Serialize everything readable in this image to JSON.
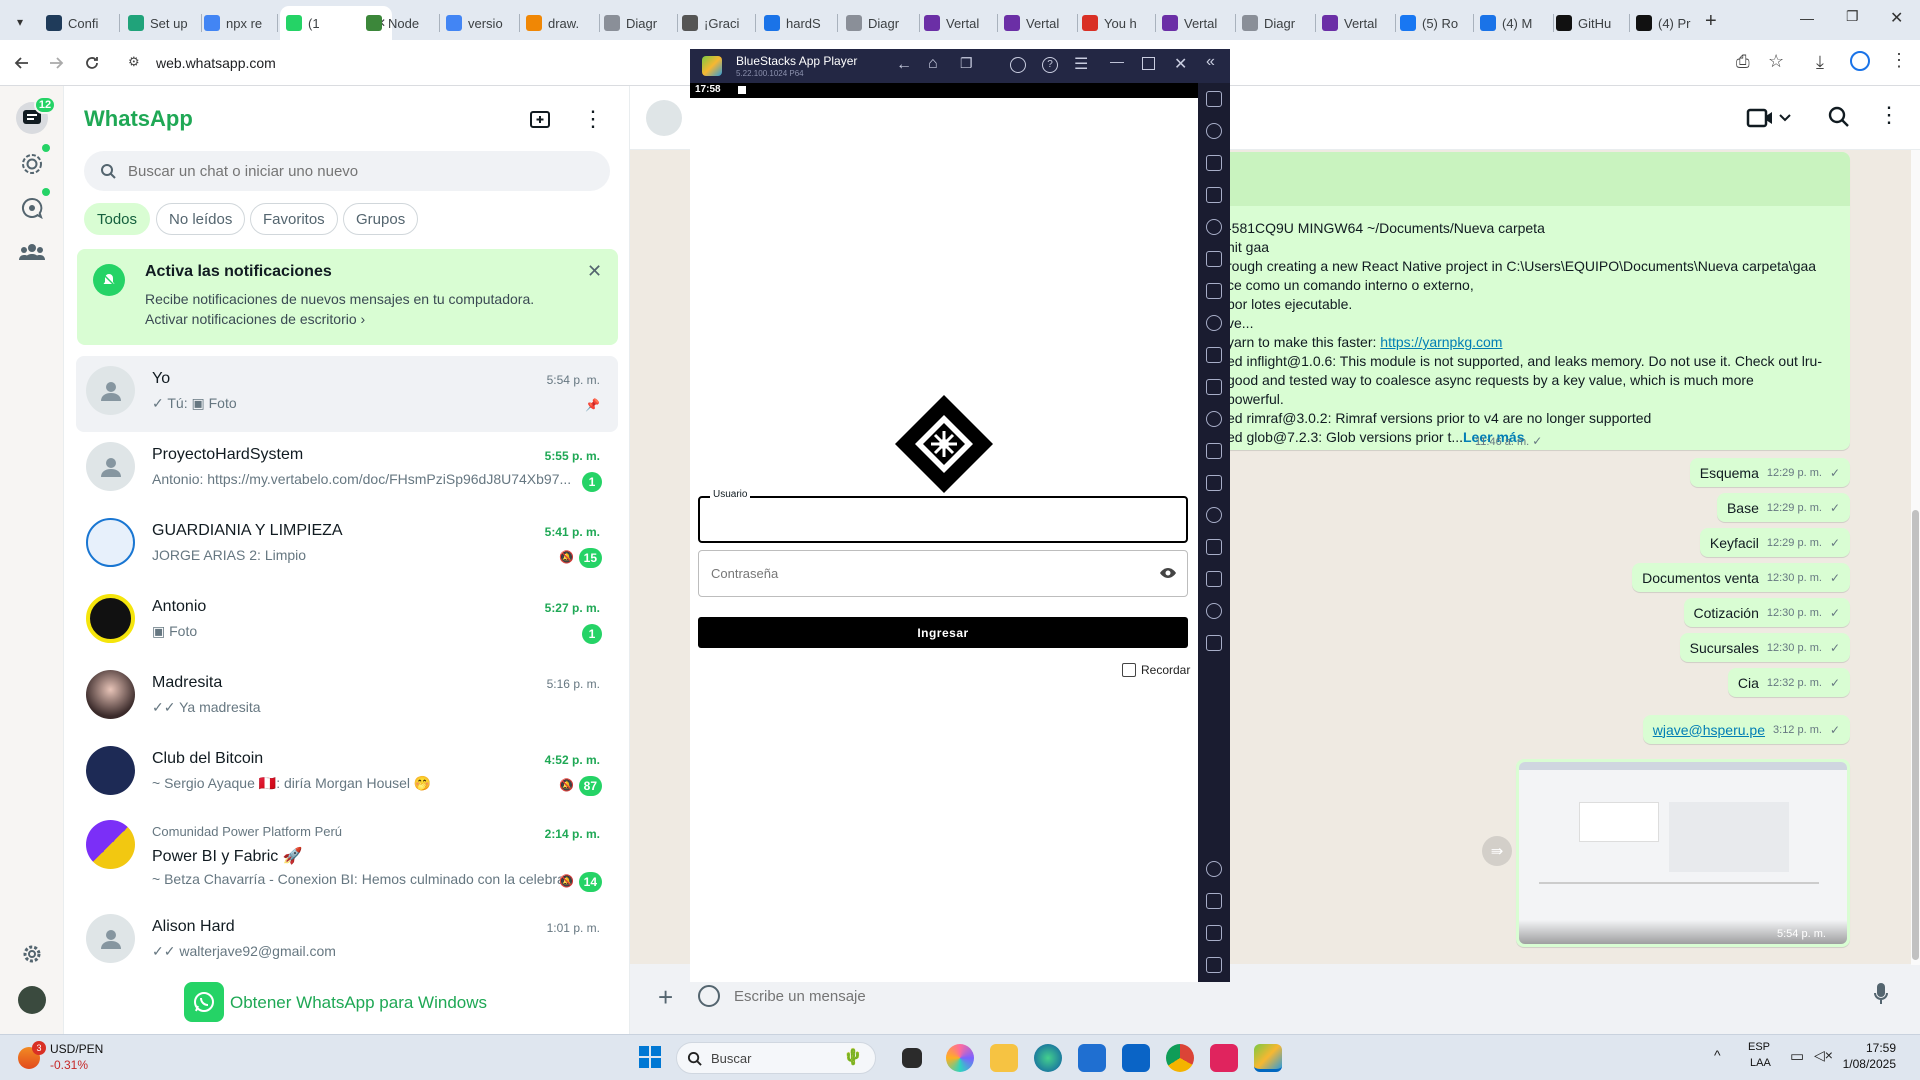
{
  "browser": {
    "tabs": [
      {
        "label": "Confi",
        "color": "#1f3b5a",
        "icon": "gear-icon"
      },
      {
        "label": "Set up",
        "color": "#20a37a",
        "icon": "page-icon"
      },
      {
        "label": "npx re",
        "color": "#4285f4",
        "icon": "google-icon"
      },
      {
        "label": "(1",
        "color": "#25d366",
        "icon": "whatsapp-icon",
        "active": true
      },
      {
        "label": "Node",
        "color": "#3c873a",
        "icon": "node-icon"
      },
      {
        "label": "versio",
        "color": "#4285f4",
        "icon": "google-icon"
      },
      {
        "label": "draw.",
        "color": "#f08705",
        "icon": "drawio-icon"
      },
      {
        "label": "Diagr",
        "color": "#8a8f98",
        "icon": "diagram-icon"
      },
      {
        "label": "¡Graci",
        "color": "#555",
        "icon": "globe-icon"
      },
      {
        "label": "hardS",
        "color": "#1a73e8",
        "icon": "drive-icon"
      },
      {
        "label": "Diagr",
        "color": "#8a8f98",
        "icon": "diagram-icon"
      },
      {
        "label": "Vertal",
        "color": "#6b2fa6",
        "icon": "vertabelo-icon"
      },
      {
        "label": "Vertal",
        "color": "#6b2fa6",
        "icon": "vertabelo-icon"
      },
      {
        "label": "You h",
        "color": "#d93025",
        "icon": "gmail-icon"
      },
      {
        "label": "Vertal",
        "color": "#6b2fa6",
        "icon": "vertabelo-icon"
      },
      {
        "label": "Diagr",
        "color": "#8a8f98",
        "icon": "diagram-icon"
      },
      {
        "label": "Vertal",
        "color": "#6b2fa6",
        "icon": "vertabelo-icon"
      },
      {
        "label": "(5) Ro",
        "color": "#1877f2",
        "icon": "reddit-icon"
      },
      {
        "label": "(4) M",
        "color": "#1a73e8",
        "icon": "search-icon"
      },
      {
        "label": "GitHu",
        "color": "#111",
        "icon": "github-icon"
      },
      {
        "label": "(4) Pr",
        "color": "#111",
        "icon": "notion-icon"
      }
    ],
    "url": "web.whatsapp.com"
  },
  "whatsapp": {
    "title": "WhatsApp",
    "unread_total": "12",
    "search_placeholder": "Buscar un chat o iniciar uno nuevo",
    "filters": [
      "Todos",
      "No leídos",
      "Favoritos",
      "Grupos"
    ],
    "notification": {
      "title": "Activa las notificaciones",
      "body": "Recibe notificaciones de nuevos mensajes en tu computadora.",
      "link": "Activar notificaciones de escritorio"
    },
    "chats": [
      {
        "name": "Yo",
        "preview": "✓ Tú: ▣ Foto",
        "time": "5:54 p. m.",
        "unread": "",
        "pinned": true,
        "avatar": "group"
      },
      {
        "name": "ProyectoHardSystem",
        "preview": "Antonio: https://my.vertabelo.com/doc/FHsmPziSp96dJ8U74Xb97...",
        "time": "5:55 p. m.",
        "unread": "1",
        "avatar": "group"
      },
      {
        "name": "GUARDIANIA Y LIMPIEZA",
        "preview": "JORGE ARIAS 2: Limpio",
        "time": "5:41 p. m.",
        "unread": "15",
        "muted": true,
        "avatar": "crest"
      },
      {
        "name": "Antonio",
        "preview": "▣ Foto",
        "time": "5:27 p. m.",
        "unread": "1",
        "avatar": "yellow"
      },
      {
        "name": "Madresita",
        "preview": "✓✓ Ya madresita",
        "time": "5:16 p. m.",
        "unread": "",
        "avatar": "photo"
      },
      {
        "name": "Club del Bitcoin",
        "preview": "~ Sergio Ayaque 🇵🇪: diría Morgan Housel 🤭",
        "time": "4:52 p. m.",
        "unread": "87",
        "muted": true,
        "avatar": "bitcoin"
      },
      {
        "name": "Power BI y Fabric 🚀",
        "community": "Comunidad Power Platform Perú",
        "preview": "~ Betza Chavarría - Conexion BI: Hemos culminado con la celebración ...",
        "time": "2:14 p. m.",
        "unread": "14",
        "muted": true,
        "avatar": "powerbi"
      },
      {
        "name": "Alison Hard",
        "preview": "✓✓ walterjave92@gmail.com",
        "time": "1:01 p. m.",
        "unread": "",
        "avatar": "person"
      }
    ],
    "get_app": "Obtener WhatsApp para Windows",
    "composer_placeholder": "Escribe un mensaje",
    "long_message": {
      "lines": [
        "-581CQ9U MINGW64 ~/Documents/Nueva carpeta",
        "nit gaa",
        "rough creating a new React Native project in C:\\Users\\EQUIPO\\Documents\\Nueva carpeta\\gaa",
        "ce como un comando interno o externo,",
        " por lotes ejecutable.",
        "ve...",
        "yarn to make this faster: ",
        "ed inflight@1.0.6: This module is not supported, and leaks memory. Do not use it. Check out lru-",
        " good and tested way to coalesce async requests by a key value, which is much more",
        " powerful.",
        "ed rimraf@3.0.2: Rimraf versions prior to v4 are no longer supported",
        "ed glob@7.2.3: Glob versions prior t..."
      ],
      "link": "https://yarnpkg.com",
      "read_more": "Leer más",
      "time": "11:46 a. m."
    },
    "messages": [
      {
        "text": "Esquema",
        "time": "12:29 p. m."
      },
      {
        "text": "Base",
        "time": "12:29 p. m."
      },
      {
        "text": "Keyfacil",
        "time": "12:29 p. m."
      },
      {
        "text": "Documentos venta",
        "time": "12:30 p. m."
      },
      {
        "text": "Cotización",
        "time": "12:30 p. m."
      },
      {
        "text": "Sucursales",
        "time": "12:30 p. m."
      },
      {
        "text": "Cia",
        "time": "12:32 p. m."
      },
      {
        "text": "wjave@hsperu.pe",
        "time": "3:12 p. m.",
        "link": true
      }
    ],
    "image_time": "5:54 p. m."
  },
  "bluestacks": {
    "title": "BlueStacks App Player",
    "version": "5.22.100.1024  P64",
    "clock": "17:58",
    "username_label": "Usuario",
    "password_placeholder": "Contraseña",
    "login_button": "Ingresar",
    "remember_label": "Recordar"
  },
  "taskbar": {
    "ticker_badge": "3",
    "ticker_name": "USD/PEN",
    "ticker_change": "-0.31%",
    "search_placeholder": "Buscar",
    "language": "ESP",
    "layout": "LAA",
    "time": "17:59",
    "date": "1/08/2025"
  }
}
